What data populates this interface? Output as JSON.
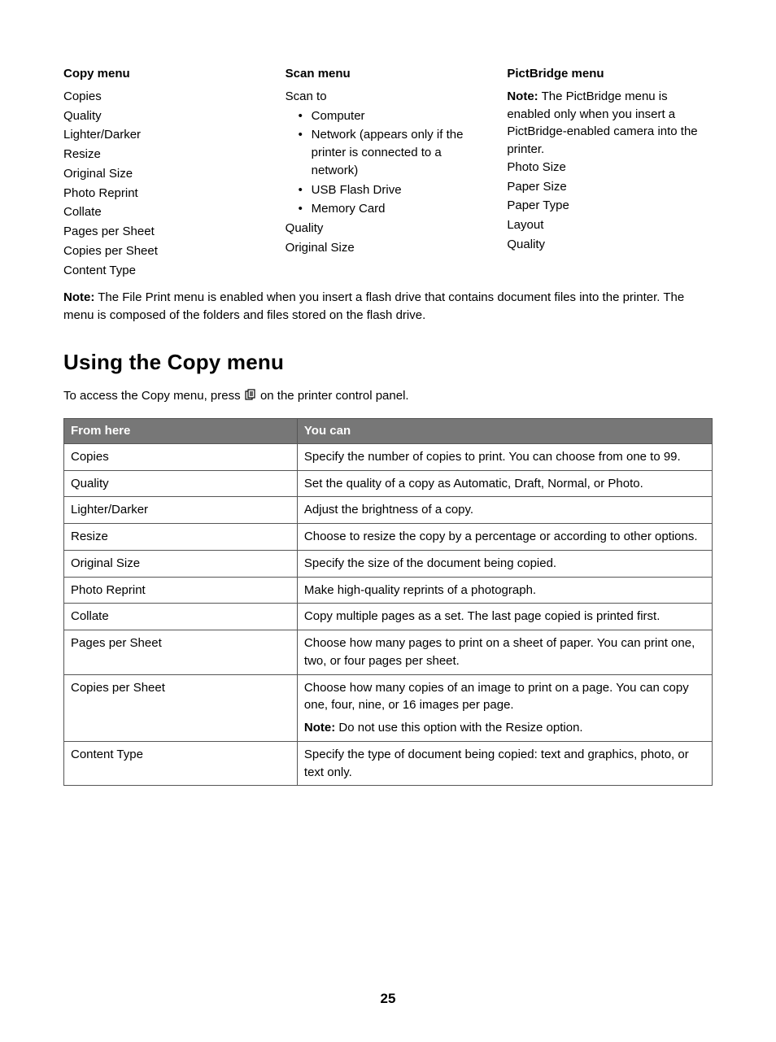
{
  "columns": {
    "copy": {
      "header": "Copy menu",
      "items": [
        "Copies",
        "Quality",
        "Lighter/Darker",
        "Resize",
        "Original Size",
        "Photo Reprint",
        "Collate",
        "Pages per Sheet",
        "Copies per Sheet",
        "Content Type"
      ]
    },
    "scan": {
      "header": "Scan menu",
      "scan_to_label": "Scan to",
      "scan_to_items": [
        "Computer",
        "Network (appears only if the printer is connected to a network)",
        "USB Flash Drive",
        "Memory Card"
      ],
      "trailing_items": [
        "Quality",
        "Original Size"
      ]
    },
    "pictbridge": {
      "header": "PictBridge menu",
      "note_label": "Note:",
      "note_text": " The PictBridge menu is enabled only when you insert a PictBridge-enabled camera into the printer.",
      "items": [
        "Photo Size",
        "Paper Size",
        "Paper Type",
        "Layout",
        "Quality"
      ]
    }
  },
  "file_print_note": {
    "label": "Note:",
    "text": " The File Print menu is enabled when you insert a flash drive that contains document files into the printer. The menu is composed of the folders and files stored on the flash drive."
  },
  "section_title": "Using the Copy menu",
  "access_line_pre": "To access the Copy menu, press ",
  "access_line_post": " on the printer control panel.",
  "table": {
    "header": {
      "col1": "From here",
      "col2": "You can"
    },
    "rows": [
      {
        "from": "Copies",
        "you_can": "Specify the number of copies to print. You can choose from one to 99."
      },
      {
        "from": "Quality",
        "you_can": "Set the quality of a copy as Automatic, Draft, Normal, or Photo."
      },
      {
        "from": "Lighter/Darker",
        "you_can": "Adjust the brightness of a copy."
      },
      {
        "from": "Resize",
        "you_can": "Choose to resize the copy by a percentage or according to other options."
      },
      {
        "from": "Original Size",
        "you_can": "Specify the size of the document being copied."
      },
      {
        "from": "Photo Reprint",
        "you_can": "Make high-quality reprints of a photograph."
      },
      {
        "from": "Collate",
        "you_can": "Copy multiple pages as a set. The last page copied is printed first."
      },
      {
        "from": "Pages per Sheet",
        "you_can": "Choose how many pages to print on a sheet of paper. You can print one, two, or four pages per sheet."
      },
      {
        "from": "Copies per Sheet",
        "you_can": "Choose how many copies of an image to print on a page. You can copy one, four, nine, or 16 images per page.",
        "note_label": "Note:",
        "note_text": " Do not use this option with the Resize option."
      },
      {
        "from": "Content Type",
        "you_can": "Specify the type of document being copied: text and graphics, photo, or text only."
      }
    ]
  },
  "page_number": "25"
}
